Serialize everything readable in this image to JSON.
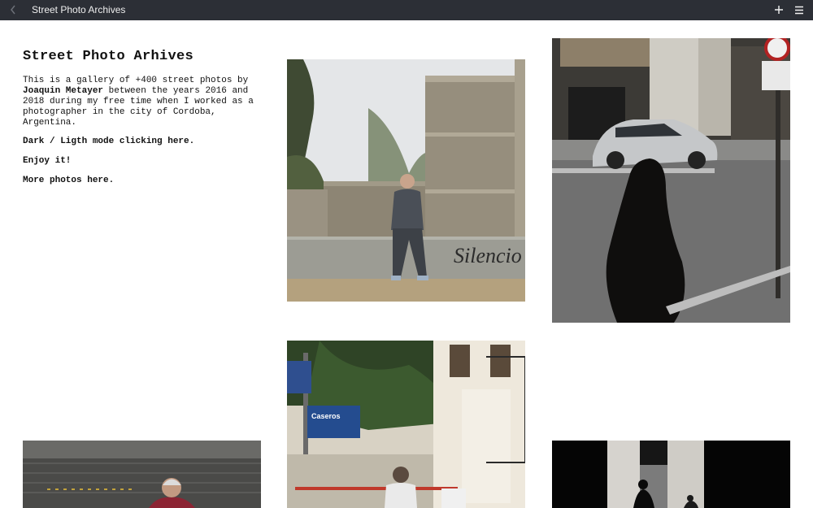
{
  "window": {
    "title": "Street Photo Archives",
    "back_icon": "chevron-left-icon",
    "add_icon": "plus-icon",
    "menu_icon": "hamburger-menu-icon"
  },
  "intro": {
    "heading": "Street Photo Arhives",
    "desc_prefix": "This is a gallery of +400 street photos by ",
    "author": "Joaquin Metayer",
    "desc_suffix": " between the years 2016 and 2018 during my free time when I worked as a photographer in the city of Cordoba, Argentina.",
    "mode_link": "Dark / Ligth mode clicking here.",
    "enjoy": "Enjoy it!",
    "more_link": "More photos here."
  },
  "gallery": {
    "photo_count": 6,
    "sign_text_1": "Silencio",
    "sign_text_2": "Caseros"
  },
  "colors": {
    "titlebar": "#2c2f36",
    "background": "#ffffff",
    "text": "#111111"
  }
}
